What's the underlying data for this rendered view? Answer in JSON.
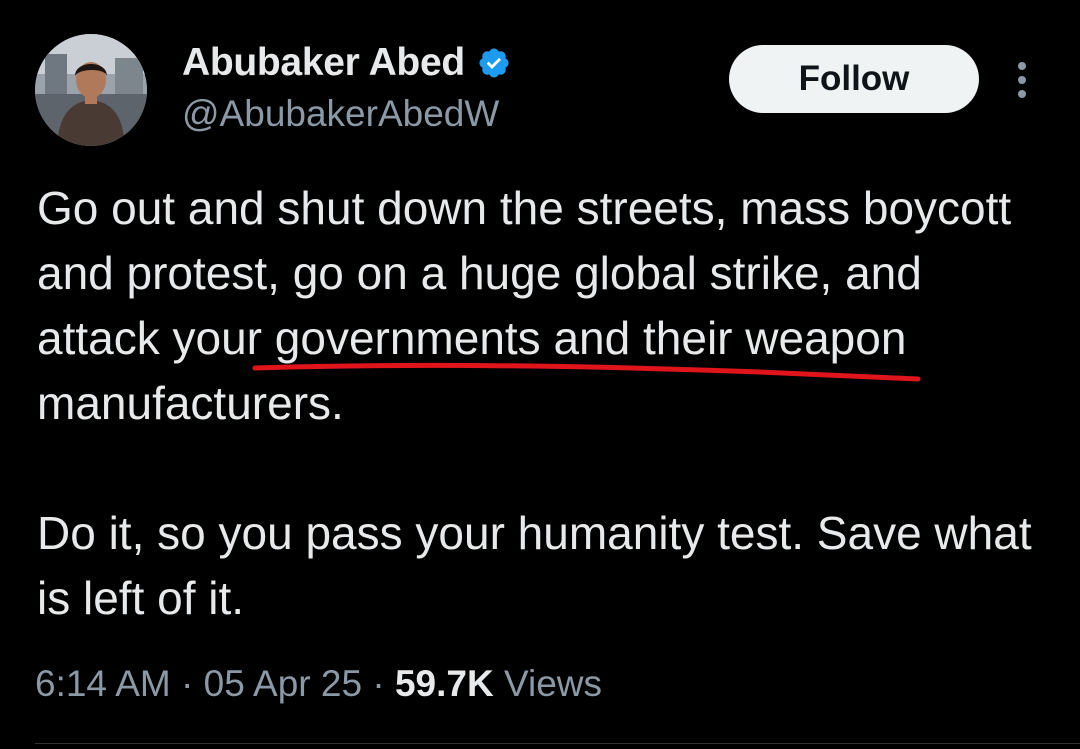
{
  "author": {
    "display_name": "Abubaker Abed",
    "handle": "@AbubakerAbedW",
    "verified": true
  },
  "header": {
    "follow_label": "Follow"
  },
  "tweet": {
    "paragraph_1": "Go out and shut down the streets, mass boycott and protest, go on a huge global strike, and attack your governments and their weapon manufacturers.",
    "paragraph_2": "Do it, so you pass your humanity test. Save what is left of it.",
    "underline_color": "#e0141b"
  },
  "meta": {
    "time": "6:14 AM",
    "separator": "·",
    "date": "05 Apr 25",
    "views_count": "59.7K",
    "views_label": "Views"
  },
  "icons": {
    "verified": "verified-badge-icon",
    "more": "more-options-icon"
  },
  "colors": {
    "background": "#000000",
    "text_primary": "#e7e9ea",
    "text_secondary": "#8b98a5",
    "verified_blue": "#1d9bf0"
  }
}
